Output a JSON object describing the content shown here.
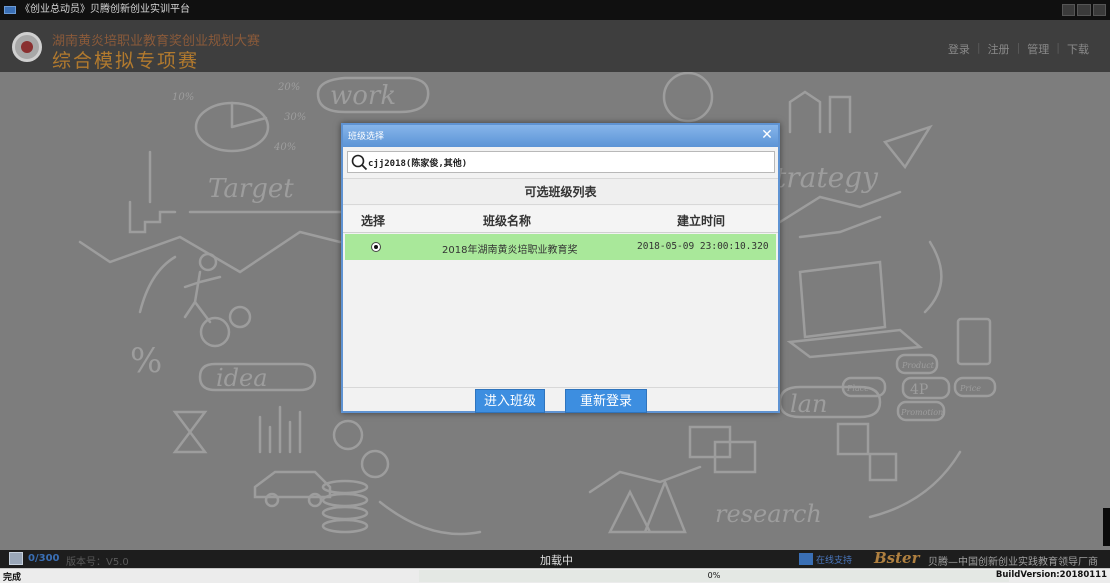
{
  "window": {
    "title": "《创业总动员》贝腾创新创业实训平台"
  },
  "header": {
    "subtitle": "湖南黄炎培职业教育奖创业规划大赛",
    "title": "综合模拟专项赛",
    "nav": [
      "登录",
      "注册",
      "管理",
      "下载"
    ]
  },
  "background": {
    "words": {
      "work": "work",
      "target": "Target",
      "strategy": "trategy",
      "idea": "idea",
      "plan": "lan",
      "research": "research",
      "four_p": "4P",
      "product": "Product",
      "place": "Place",
      "price": "Price",
      "promotion": "Promotion",
      "percent_big": "%",
      "pct_10": "10%",
      "pct_20": "20%",
      "pct_30": "30%",
      "pct_40": "40%"
    }
  },
  "dialog": {
    "title": "班级选择",
    "search_value": "cjj2018(陈家俊,其他)",
    "list_title": "可选班级列表",
    "columns": [
      "选择",
      "班级名称",
      "建立时间"
    ],
    "rows": [
      {
        "selected": true,
        "name": "2018年湖南黄炎培职业教育奖",
        "created": "2018-05-09 23:00:10.320"
      }
    ],
    "buttons": {
      "enter": "进入班级",
      "relogin": "重新登录"
    }
  },
  "status": {
    "online_count": "0/300",
    "version": "版本号：V5.0",
    "loading": "加载中",
    "service": "在线支持",
    "brand": "Bster",
    "slogan": "贝腾—中国创新创业实践教育领导厂商"
  },
  "browser": {
    "done": "完成",
    "progress": "0%",
    "progress_value": 0,
    "build": "BuildVersion:20180111"
  },
  "colors": {
    "accent": "#3d8ee0",
    "selected_row": "#a9e89a",
    "dialog_header": "#5c94d6",
    "header_title": "#b27a2e"
  }
}
